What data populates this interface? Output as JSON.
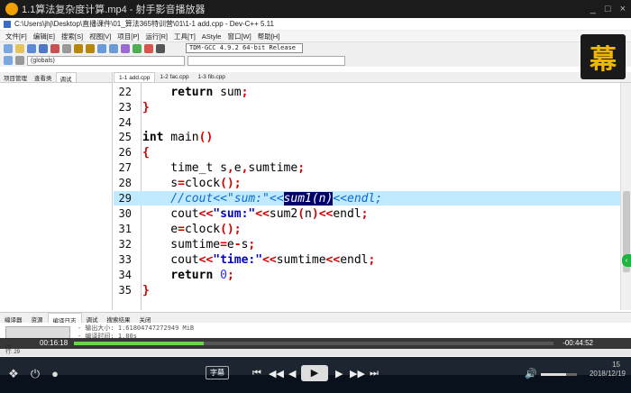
{
  "player": {
    "title": "1.1算法复杂度计算.mp4 - 射手影音播放器",
    "controls": [
      "_",
      "□",
      "×"
    ],
    "danmu_label": "幕",
    "elapsed": "00:16:18",
    "remaining": "-00:44:52",
    "progress": 0.27,
    "volume": 0.7,
    "subtitle_label": "字幕",
    "date": "2018/12/19",
    "time_fragment": "15",
    "buttons": {
      "prev": "⏮",
      "rew": "◀◀",
      "back": "◀",
      "play": "▶",
      "fwd": "▶",
      "ffwd": "▶▶",
      "next": "⏭"
    }
  },
  "ide": {
    "title": "C:\\Users\\jhj\\Desktop\\直播课件\\01_算法365特训营\\01\\1-1 add.cpp - Dev-C++ 5.11",
    "menu": [
      "文件[F]",
      "编辑[E]",
      "搜索[S]",
      "视图[V]",
      "项目[P]",
      "运行[R]",
      "工具[T]",
      "AStyle",
      "窗口[W]",
      "帮助[H]"
    ],
    "compiler": "TDM-GCC 4.9.2 64-bit Release",
    "scope_combo": "(globals)",
    "left_tabs": [
      "项目管理",
      "查看类",
      "调试"
    ],
    "file_tabs": [
      "1-1 add.cpp",
      "1-2 fac.cpp",
      "1-3 fib.cpp"
    ],
    "bottom_tabs": [
      "编译器",
      "资源",
      "编译日志",
      "调试",
      "搜索结果",
      "关闭"
    ],
    "left_button": "",
    "log_lines": [
      "- 输出大小: 1.61804747272949 MiB",
      "- 编译时间: 1.80s"
    ],
    "status_line": "行: 29",
    "lines": [
      {
        "n": "22",
        "text": "    return sum;"
      },
      {
        "n": "23",
        "text": "}"
      },
      {
        "n": "24",
        "text": ""
      },
      {
        "n": "25",
        "text": "int main()"
      },
      {
        "n": "26",
        "text": "{"
      },
      {
        "n": "27",
        "text": "    time_t s,e,sumtime;"
      },
      {
        "n": "28",
        "text": "    s=clock();"
      },
      {
        "n": "29",
        "text": "    //cout<<\"sum:\"<<sum1(n)<<endl;"
      },
      {
        "n": "30",
        "text": "    cout<<\"sum:\"<<sum2(n)<<endl;"
      },
      {
        "n": "31",
        "text": "    e=clock();"
      },
      {
        "n": "32",
        "text": "    sumtime=e-s;"
      },
      {
        "n": "33",
        "text": "    cout<<\"time:\"<<sumtime<<endl;"
      },
      {
        "n": "34",
        "text": "    return 0;"
      },
      {
        "n": "35",
        "text": "}"
      }
    ]
  }
}
